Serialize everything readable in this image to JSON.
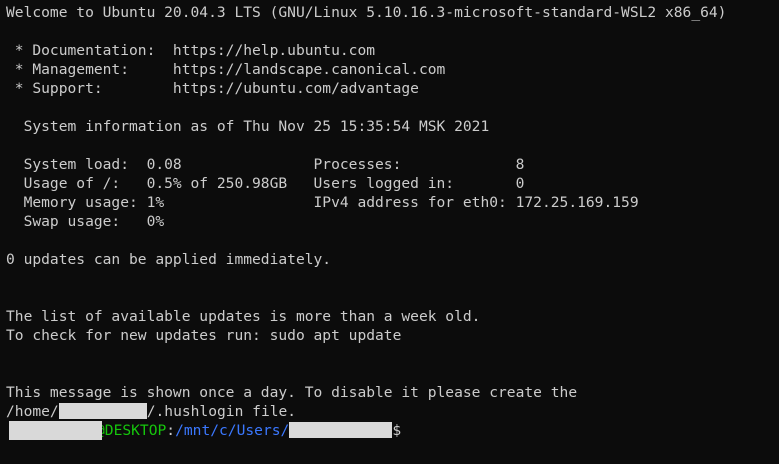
{
  "terminal": {
    "lines": [
      "Welcome to Ubuntu 20.04.3 LTS (GNU/Linux 5.10.16.3-microsoft-standard-WSL2 x86_64)",
      "",
      " * Documentation:  https://help.ubuntu.com",
      " * Management:     https://landscape.canonical.com",
      " * Support:        https://ubuntu.com/advantage",
      "",
      "  System information as of Thu Nov 25 15:35:54 MSK 2021",
      "",
      "  System load:  0.08               Processes:             8",
      "  Usage of /:   0.5% of 250.98GB   Users logged in:       0",
      "  Memory usage: 1%                 IPv4 address for eth0: 172.25.169.159",
      "  Swap usage:   0%",
      "",
      "0 updates can be applied immediately.",
      "",
      "",
      "The list of available updates is more than a week old.",
      "To check for new updates run: sudo apt update",
      "",
      "",
      "This message is shown once a day. To disable it please create the"
    ],
    "hushlogin": {
      "prefix": "/home/",
      "suffix": "/.hushlogin file."
    },
    "prompt": {
      "host": "@DESKTOP",
      "separator": ":",
      "path": "/mnt/c/Users/",
      "symbol": "$"
    },
    "colors": {
      "background": "#0c0c0c",
      "text": "#cccccc",
      "host": "#16c60c",
      "path": "#3b78ff",
      "redaction": "#d9d9d9"
    }
  }
}
